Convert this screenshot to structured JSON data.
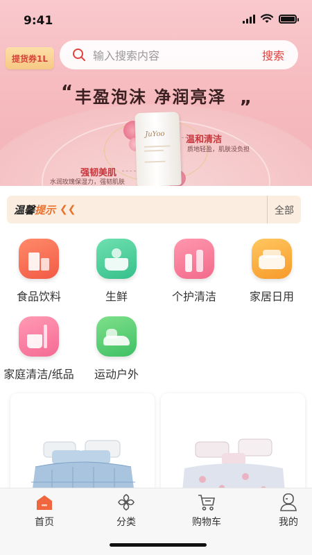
{
  "status_bar": {
    "time": "9:41"
  },
  "header": {
    "coupon_label": "提货券1L",
    "search_placeholder": "输入搜索内容",
    "search_button": "搜索"
  },
  "banner": {
    "quote_open": "“",
    "slogan": "丰盈泡沫 净润亮泽",
    "quote_close": "„",
    "product_brand": "JuYoo",
    "feature_right_title": "温和清洁",
    "feature_right_sub": "质地轻盈，肌肤没负担",
    "feature_left_title": "强韧美肌",
    "feature_left_sub": "水润玫瑰保湿力，强韧肌肤"
  },
  "notice": {
    "title_part1": "温馨",
    "title_part2": "提示",
    "arrows": "❮❮",
    "all_label": "全部"
  },
  "categories": [
    {
      "label": "食品饮料",
      "icon": "milk-carton-icon"
    },
    {
      "label": "生鲜",
      "icon": "basket-icon"
    },
    {
      "label": "个护清洁",
      "icon": "lipstick-icon"
    },
    {
      "label": "家居日用",
      "icon": "sofa-icon"
    },
    {
      "label": "家庭清洁/纸品",
      "icon": "cleaning-bucket-icon"
    },
    {
      "label": "运动户外",
      "icon": "sneaker-icon"
    }
  ],
  "tabbar": {
    "items": [
      {
        "label": "首页",
        "icon": "home-icon",
        "active": true
      },
      {
        "label": "分类",
        "icon": "category-grid-icon",
        "active": false
      },
      {
        "label": "购物车",
        "icon": "cart-icon",
        "active": false
      },
      {
        "label": "我的",
        "icon": "user-icon",
        "active": false
      }
    ]
  },
  "colors": {
    "accent": "#e1403c",
    "hero_pink": "#f6bcc0",
    "notice_bg": "#fbeee0",
    "tab_active": "#f0663e"
  }
}
